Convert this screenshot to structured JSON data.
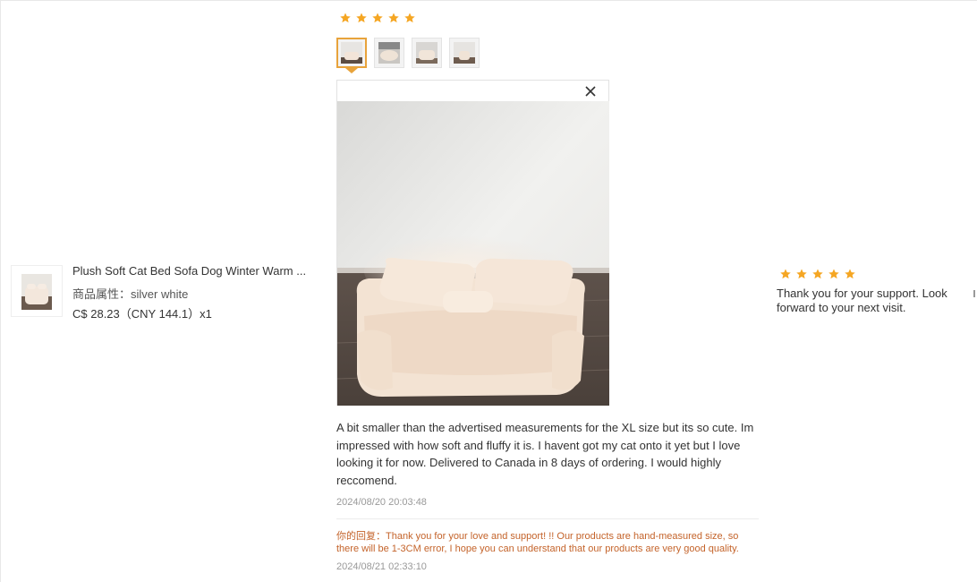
{
  "product": {
    "title": "Plush Soft Cat Bed Sofa Dog Winter Warm ...",
    "attribute": "商品属性：silver white",
    "price": "C$ 28.23（CNY  144.1）x1"
  },
  "review": {
    "rating": 5,
    "text": "A bit smaller than the advertised measurements for the XL size but its so cute. Im impressed with how soft and fluffy it is. I havent got my cat onto it yet but I love looking it for now. Delivered to Canada in 8 days of ordering. I would highly reccomend.",
    "timestamp": "2024/08/20 20:03:48",
    "reply": "你的回复：Thank you for your love and support! !! Our products are hand-measured size, so there will be 1-3CM error, I hope you can understand that our products are very good quality.",
    "reply_timestamp": "2024/08/21 02:33:10"
  },
  "seller_feedback": {
    "rating": 5,
    "text": "Thank you for your support. Look forward to your next visit."
  },
  "icons": {
    "star_color": "#f5a623",
    "close": "close-icon"
  }
}
